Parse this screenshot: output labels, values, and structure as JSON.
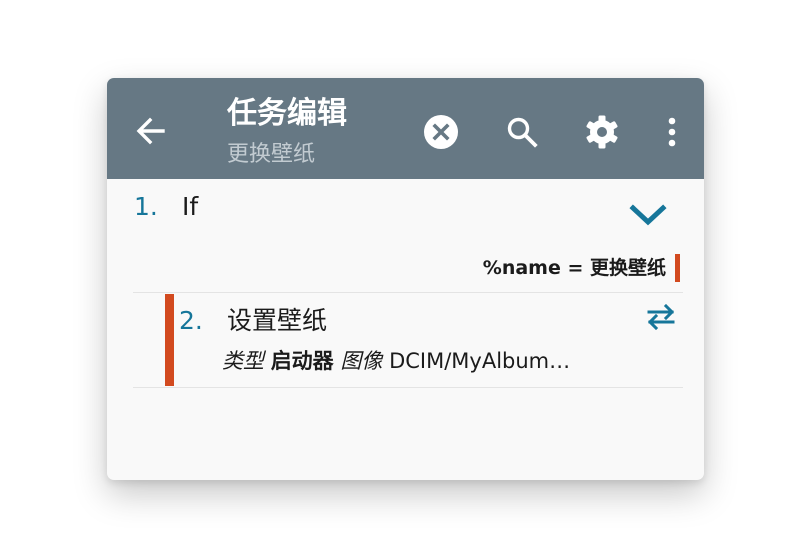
{
  "colors": {
    "appbar": "#667884",
    "accent_red": "#d24a1f",
    "accent_blue": "#16769a",
    "background": "#f9f9f9"
  },
  "appbar": {
    "title": "任务编辑",
    "subtitle": "更换壁纸",
    "icons": [
      "back-arrow-icon",
      "cancel-circle-icon",
      "search-icon",
      "gear-icon",
      "more-vert-icon"
    ]
  },
  "actions": [
    {
      "number": "1.",
      "label": "If",
      "condition": "%name = 更换壁纸",
      "icon": "chevron-down-icon"
    },
    {
      "number": "2.",
      "label": "设置壁纸",
      "icon": "swap-arrows-icon",
      "params": [
        {
          "key": "类型",
          "value": "启动器"
        },
        {
          "key": "图像",
          "value": "DCIM/MyAlbum…"
        }
      ]
    }
  ]
}
